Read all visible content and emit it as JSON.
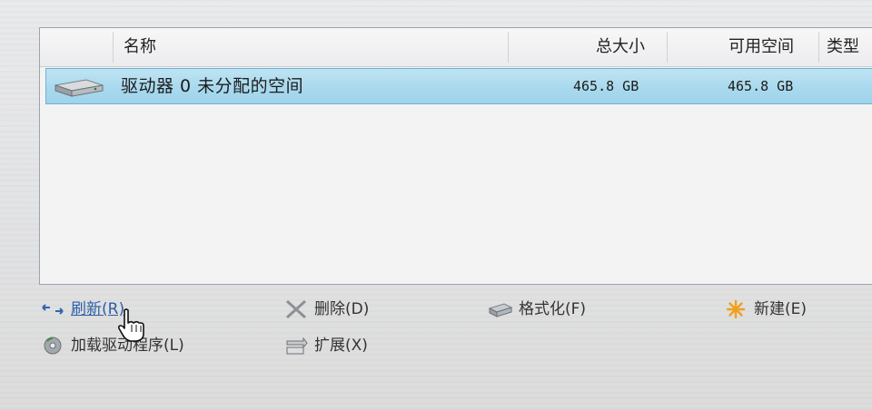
{
  "table": {
    "columns": {
      "name": "名称",
      "total_size": "总大小",
      "free_space": "可用空间",
      "type": "类型"
    },
    "rows": [
      {
        "name": "驱动器 0 未分配的空间",
        "total_size": "465.8 GB",
        "free_space": "465.8 GB",
        "icon": "hard-drive-icon",
        "selected": true
      }
    ]
  },
  "actions": {
    "refresh": "刷新(R)",
    "delete": "删除(D)",
    "format": "格式化(F)",
    "new": "新建(E)",
    "load_driver": "加载驱动程序(L)",
    "extend": "扩展(X)"
  },
  "colors": {
    "selection": "#a9d9ee",
    "selection_border": "#6fb3d2",
    "link": "#2d5fa8",
    "new_star": "#f0a020"
  }
}
